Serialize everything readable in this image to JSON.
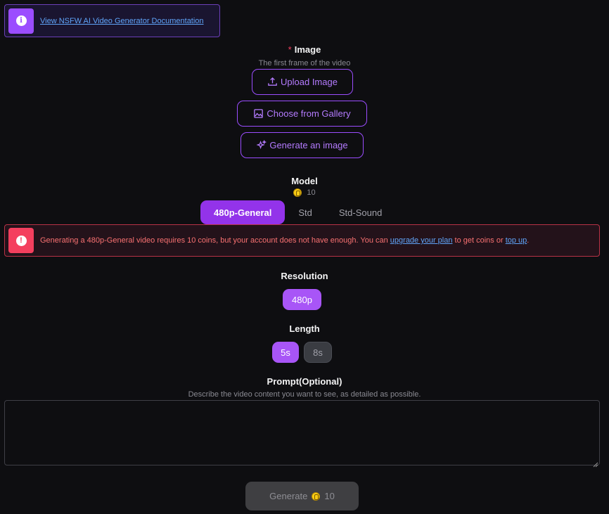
{
  "banner": {
    "link_text": "View NSFW AI Video Generator Documentation"
  },
  "image_section": {
    "required_mark": "*",
    "label": "Image",
    "sublabel": "The first frame of the video",
    "upload_label": "Upload Image",
    "gallery_label": "Choose from Gallery",
    "generate_label": "Generate an image"
  },
  "model": {
    "label": "Model",
    "cost": "10",
    "tabs": [
      {
        "label": "480p-General",
        "active": true
      },
      {
        "label": "Std",
        "active": false
      },
      {
        "label": "Std-Sound",
        "active": false
      }
    ]
  },
  "error": {
    "text_before": "Generating a 480p-General video requires 10 coins, but your account does not have enough. You can ",
    "upgrade_link": "upgrade your plan",
    "text_middle": " to get coins or ",
    "topup_link": "top up",
    "text_after": "."
  },
  "resolution": {
    "label": "Resolution",
    "options": [
      "480p"
    ],
    "selected": "480p"
  },
  "length": {
    "label": "Length",
    "options": [
      "5s",
      "8s"
    ],
    "selected": "5s"
  },
  "prompt": {
    "label": "Prompt(Optional)",
    "sublabel": "Describe the video content you want to see, as detailed as possible.",
    "value": ""
  },
  "generate": {
    "label": "Generate",
    "cost": "10"
  },
  "colors": {
    "accent": "#9333ea",
    "accent_light": "#a855f7",
    "error": "#f43f5e",
    "link": "#60a5fa",
    "coin": "#facc15"
  }
}
